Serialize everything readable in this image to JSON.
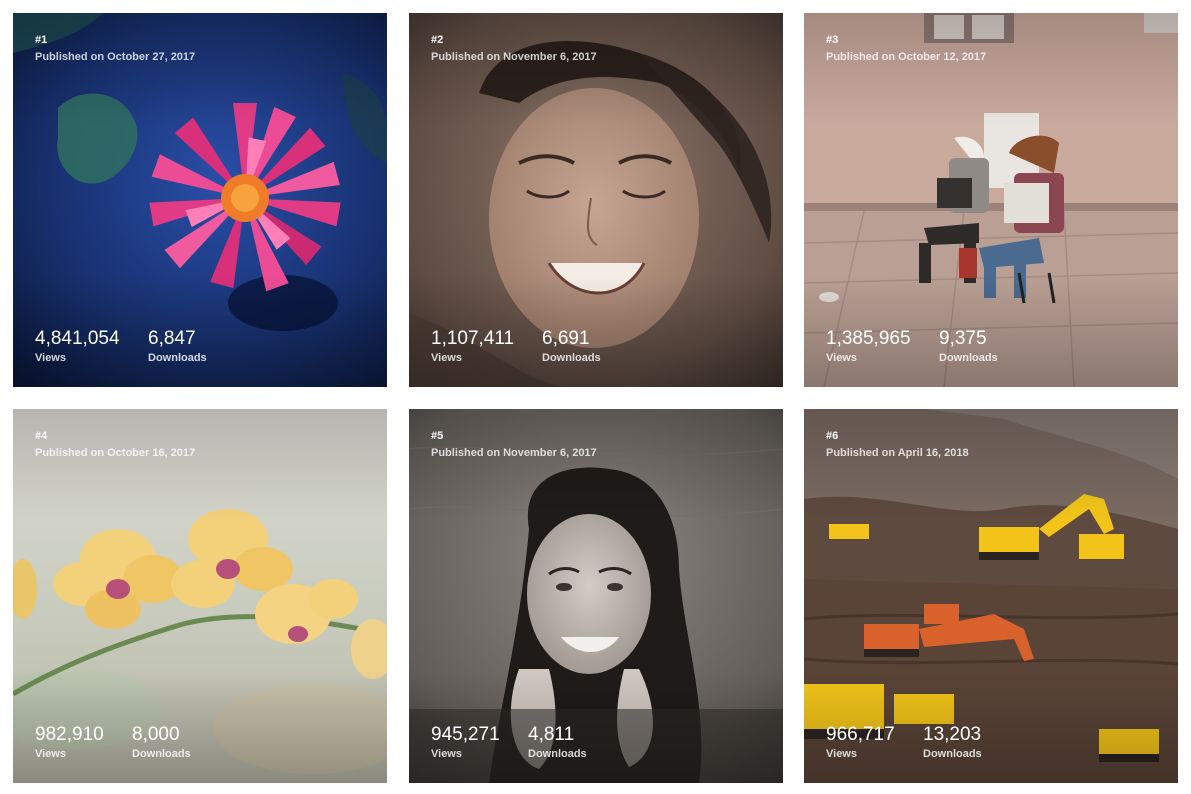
{
  "photos": [
    {
      "rank": "#1",
      "published": "Published on October 27, 2017",
      "views": "4,841,054",
      "views_label": "Views",
      "downloads": "6,847",
      "downloads_label": "Downloads"
    },
    {
      "rank": "#2",
      "published": "Published on November 6, 2017",
      "views": "1,107,411",
      "views_label": "Views",
      "downloads": "6,691",
      "downloads_label": "Downloads"
    },
    {
      "rank": "#3",
      "published": "Published on October 12, 2017",
      "views": "1,385,965",
      "views_label": "Views",
      "downloads": "9,375",
      "downloads_label": "Downloads"
    },
    {
      "rank": "#4",
      "published": "Published on October 16, 2017",
      "views": "982,910",
      "views_label": "Views",
      "downloads": "8,000",
      "downloads_label": "Downloads"
    },
    {
      "rank": "#5",
      "published": "Published on November 6, 2017",
      "views": "945,271",
      "views_label": "Views",
      "downloads": "4,811",
      "downloads_label": "Downloads"
    },
    {
      "rank": "#6",
      "published": "Published on April 16, 2018",
      "views": "966,717",
      "views_label": "Views",
      "downloads": "13,203",
      "downloads_label": "Downloads"
    }
  ],
  "colors": {
    "background": "#ffffff",
    "text": "#ffffff"
  }
}
